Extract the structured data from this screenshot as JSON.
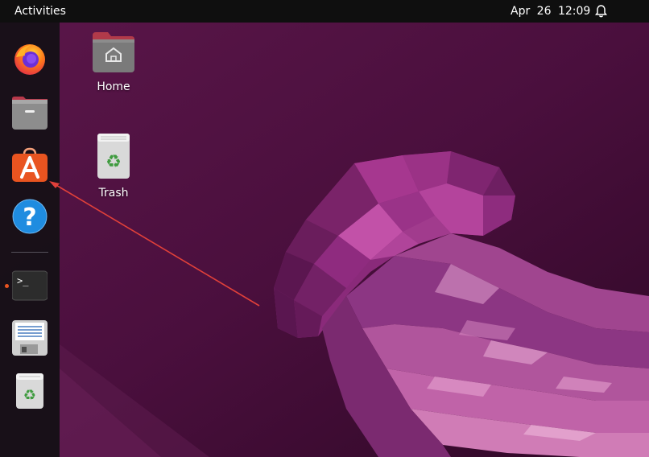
{
  "topbar": {
    "activities_label": "Activities",
    "date": "Apr 26",
    "time": "12:09",
    "notification_icon": "bell-icon"
  },
  "dock": {
    "items": [
      {
        "name": "Firefox",
        "icon": "firefox-icon"
      },
      {
        "name": "Files",
        "icon": "file-cabinet-icon"
      },
      {
        "name": "Ubuntu Software",
        "icon": "app-store-icon"
      },
      {
        "name": "Help",
        "icon": "help-icon"
      },
      {
        "name": "Terminal",
        "icon": "terminal-icon",
        "running": true
      },
      {
        "name": "Save / Document",
        "icon": "floppy-icon"
      },
      {
        "name": "Trash",
        "icon": "trash-icon"
      }
    ],
    "terminal_prompt": ">_"
  },
  "desktop": {
    "icons": [
      {
        "label": "Home",
        "icon": "home-folder-icon"
      },
      {
        "label": "Trash",
        "icon": "trash-icon"
      }
    ]
  },
  "colors": {
    "accent": "#e95420",
    "topbar_bg": "#0f0f0f",
    "wallpaper_base": "#4a0f3d",
    "annotation_arrow": "#e0403a"
  }
}
